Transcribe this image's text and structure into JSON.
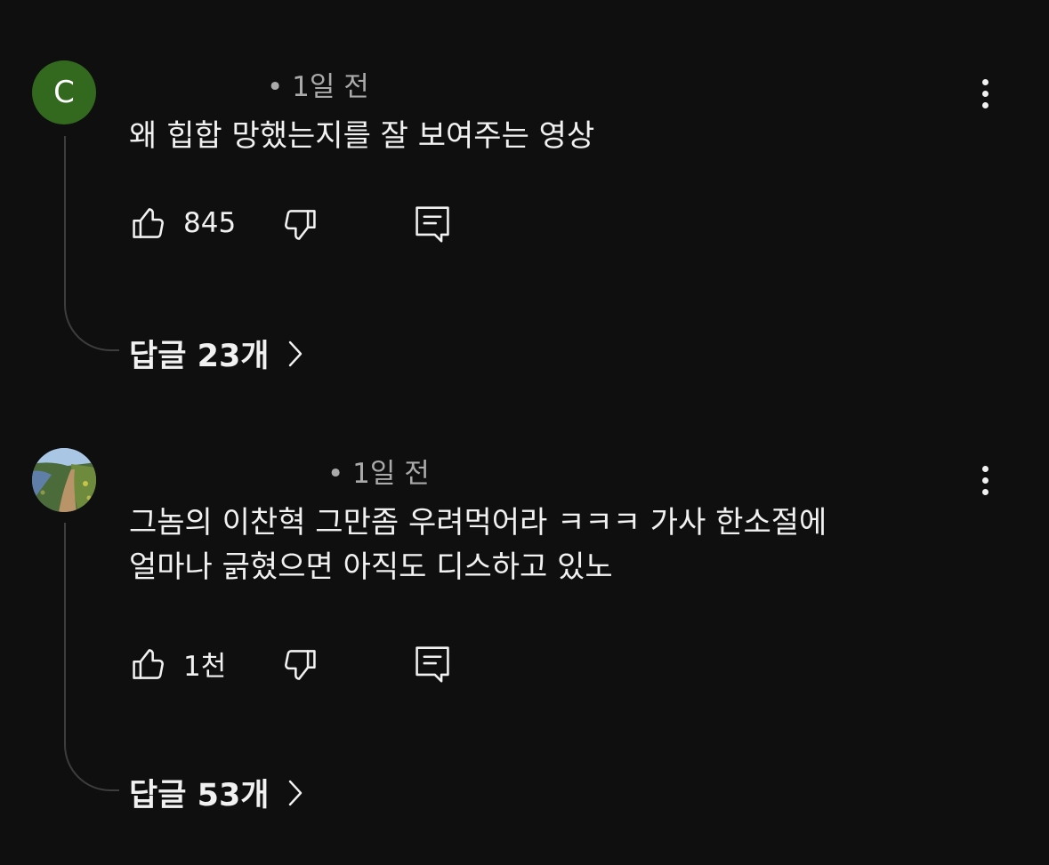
{
  "comments": [
    {
      "avatar_letter": "C",
      "avatar_color": "#33691e",
      "timestamp": "• 1일 전",
      "text_lines": [
        "왜 힙합 망했는지를 잘 보여주는 영상"
      ],
      "likes": "845",
      "replies_label": "답글 23개",
      "icons": {
        "like": "thumb-up-icon",
        "dislike": "thumb-down-icon",
        "reply": "reply-icon",
        "more": "more-vert-icon",
        "expand": "chevron-right-icon"
      }
    },
    {
      "avatar_image": "trail-landscape-photo",
      "timestamp": "• 1일 전",
      "text_lines": [
        "그놈의 이찬혁 그만좀 우려먹어라 ㅋㅋㅋ 가사 한소절에",
        "얼마나 긁혔으면 아직도 디스하고 있노"
      ],
      "likes": "1천",
      "replies_label": "답글 53개",
      "icons": {
        "like": "thumb-up-icon",
        "dislike": "thumb-down-icon",
        "reply": "reply-icon",
        "more": "more-vert-icon",
        "expand": "chevron-right-icon"
      }
    }
  ],
  "colors": {
    "background": "#0f0f0f",
    "text": "#f1f1f1",
    "secondary_text": "#aaaaaa",
    "thread_line": "#3d3d3d"
  }
}
